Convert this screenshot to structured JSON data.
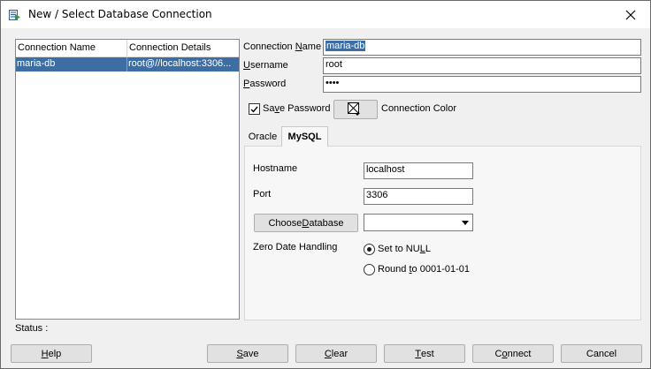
{
  "window": {
    "title": "New / Select Database Connection"
  },
  "connections": {
    "columns": [
      "Connection Name",
      "Connection Details"
    ],
    "rows": [
      {
        "name": "maria-db",
        "details": "root@//localhost:3306..."
      }
    ]
  },
  "form": {
    "connection_name": {
      "label_pre": "Connection ",
      "label_ul": "N",
      "label_post": "ame",
      "value": "maria-db"
    },
    "username": {
      "label_ul": "U",
      "label_post": "sername",
      "value": "root"
    },
    "password": {
      "label_ul": "P",
      "label_post": "assword",
      "value": "••••"
    },
    "save_password": {
      "label_pre": "Sa",
      "label_ul": "v",
      "label_post": "e Password",
      "checked": true
    },
    "connection_color_label": "Connection Color"
  },
  "tabs": [
    {
      "label": "Oracle",
      "active": false
    },
    {
      "label": "MySQL",
      "active": true
    }
  ],
  "mysql": {
    "hostname": {
      "label": "Hostname",
      "value": "localhost"
    },
    "port": {
      "label": "Port",
      "value": "3306"
    },
    "choose_database": {
      "label_pre": "Choose ",
      "label_ul": "D",
      "label_post": "atabase",
      "value": ""
    },
    "zero_date": {
      "label": "Zero Date Handling",
      "options": [
        {
          "pre": "Set to NU",
          "ul": "L",
          "post": "L",
          "selected": true
        },
        {
          "pre": "Round ",
          "ul": "t",
          "post": "o 0001-01-01",
          "selected": false
        }
      ]
    }
  },
  "status": {
    "label": "Status :"
  },
  "buttons": {
    "help": {
      "ul": "H",
      "post": "elp"
    },
    "save": {
      "ul": "S",
      "post": "ave"
    },
    "clear": {
      "ul": "C",
      "post": "lear"
    },
    "test": {
      "ul": "T",
      "post": "est"
    },
    "connect": {
      "pre": "C",
      "ul": "o",
      "post": "nnect"
    },
    "cancel": {
      "label": "Cancel"
    }
  },
  "colors": {
    "selection": "#3c6ea3",
    "window_bg": "#f0f0f0"
  }
}
